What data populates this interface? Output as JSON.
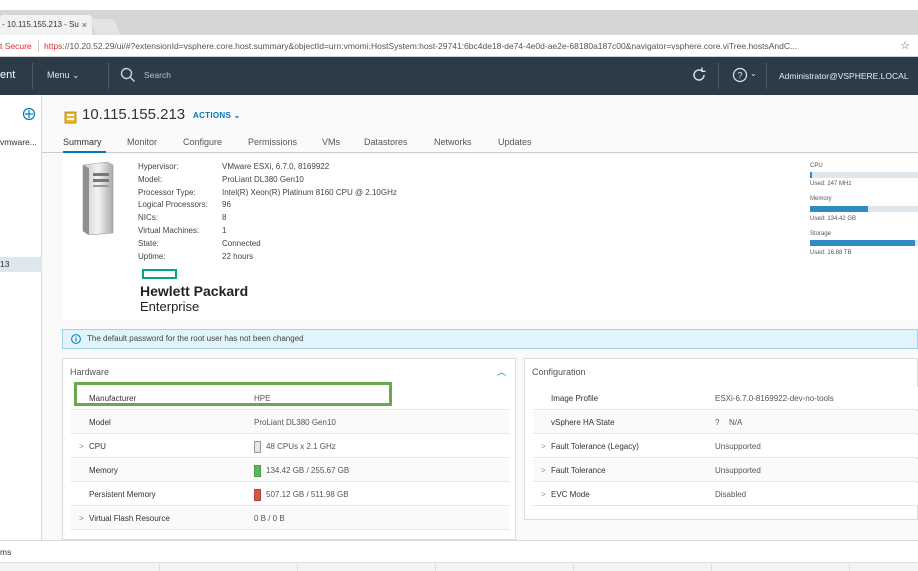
{
  "browser": {
    "tab_title": "- 10.115.155.213 - Su",
    "tab_close": "×",
    "address_secure": "t Secure",
    "address_scheme": "https:",
    "address_rest": "//10.20.52.29/ui/#?extensionId=vsphere.core.host.summary&objectId=urn:vmomi:HostSystem:host-29741:6bc4de18-de74-4e0d-ae2e-68180a187c00&navigator=vsphere.core.viTree.hostsAndC..."
  },
  "header": {
    "app_title": "ent",
    "menu_label": "Menu",
    "search_placeholder": "Search",
    "user": "Administrator@VSPHERE.LOCAL"
  },
  "navigator": {
    "item1": "vmware...",
    "selected": "13"
  },
  "host": {
    "title": "10.115.155.213",
    "actions_label": "ACTIONS"
  },
  "tabs": [
    "Summary",
    "Monitor",
    "Configure",
    "Permissions",
    "VMs",
    "Datastores",
    "Networks",
    "Updates"
  ],
  "specs": [
    {
      "label": "Hypervisor:",
      "value": "VMware ESXi, 6.7.0, 8169922"
    },
    {
      "label": "Model:",
      "value": "ProLiant DL380 Gen10"
    },
    {
      "label": "Processor Type:",
      "value": "Intel(R) Xeon(R) Platinum 8160 CPU @ 2.10GHz"
    },
    {
      "label": "Logical Processors:",
      "value": "96"
    },
    {
      "label": "NICs:",
      "value": "8"
    },
    {
      "label": "Virtual Machines:",
      "value": "1"
    },
    {
      "label": "State:",
      "value": "Connected"
    },
    {
      "label": "Uptime:",
      "value": "22 hours"
    }
  ],
  "logo": {
    "line1": "Hewlett Packard",
    "line2": "Enterprise"
  },
  "resources": {
    "cpu_label": "CPU",
    "cpu_used": "Used: 247 MHz",
    "cpu_fill": 0.02,
    "memory_label": "Memory",
    "memory_used": "Used: 134.42 GB",
    "memory_fill": 0.53,
    "storage_label": "Storage",
    "storage_used": "Used: 16.88 TB",
    "storage_fill": 0.95
  },
  "alert": {
    "text": "The default password for the root user has not been changed"
  },
  "hardware": {
    "title": "Hardware",
    "rows": [
      {
        "label": "Manufacturer",
        "value": "HPE",
        "chevron": ""
      },
      {
        "label": "Model",
        "value": "ProLiant DL380 Gen10",
        "chevron": ""
      },
      {
        "label": "CPU",
        "value": "48 CPUs x 2.1 GHz",
        "chevron": ">"
      },
      {
        "label": "Memory",
        "value": "134.42 GB / 255.67 GB",
        "chevron": ""
      },
      {
        "label": "Persistent Memory",
        "value": "507.12 GB / 511.98 GB",
        "chevron": ""
      },
      {
        "label": "Virtual Flash Resource",
        "value": "0 B / 0 B",
        "chevron": ">"
      }
    ]
  },
  "configuration": {
    "title": "Configuration",
    "rows": [
      {
        "label": "Image Profile",
        "value": "ESXi-6.7.0-8169922-dev-no-tools",
        "chevron": ""
      },
      {
        "label": "vSphere HA State",
        "value": "N/A",
        "chevron": ""
      },
      {
        "label": "Fault Tolerance (Legacy)",
        "value": "Unsupported",
        "chevron": ">"
      },
      {
        "label": "Fault Tolerance",
        "value": "Unsupported",
        "chevron": ">"
      },
      {
        "label": "EVC Mode",
        "value": "Disabled",
        "chevron": ">"
      }
    ]
  },
  "bottom": {
    "label": "ms"
  },
  "colors": {
    "accent": "#0079b8",
    "header_bg": "#2b3b48",
    "highlight": "#6aa84f",
    "memory_gauge": "#5cb85c",
    "pmem_gauge": "#d9534f"
  }
}
